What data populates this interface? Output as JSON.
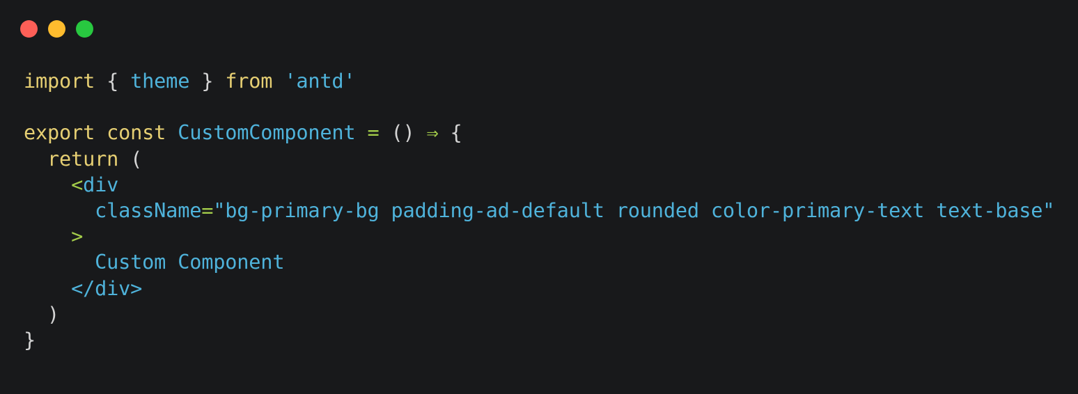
{
  "window": {
    "controls": [
      {
        "name": "close",
        "color": "#fe5f57"
      },
      {
        "name": "minimize",
        "color": "#febc2e"
      },
      {
        "name": "maximize",
        "color": "#28c840"
      }
    ]
  },
  "colors": {
    "background": "#18191b",
    "keyword": "#e6cf73",
    "identifier": "#4fb3db",
    "operator": "#a3cc4a",
    "punctuation": "#d4d4d4"
  },
  "code": {
    "lines": [
      [
        {
          "t": "import",
          "c": "kw"
        },
        {
          "t": " { ",
          "c": "punc"
        },
        {
          "t": "theme",
          "c": "id"
        },
        {
          "t": " } ",
          "c": "punc"
        },
        {
          "t": "from",
          "c": "kw"
        },
        {
          "t": " ",
          "c": "punc"
        },
        {
          "t": "'antd'",
          "c": "str"
        }
      ],
      [],
      [
        {
          "t": "export",
          "c": "kw"
        },
        {
          "t": " ",
          "c": "punc"
        },
        {
          "t": "const",
          "c": "kw"
        },
        {
          "t": " ",
          "c": "punc"
        },
        {
          "t": "CustomComponent",
          "c": "id"
        },
        {
          "t": " ",
          "c": "punc"
        },
        {
          "t": "=",
          "c": "op"
        },
        {
          "t": " () ",
          "c": "punc"
        },
        {
          "t": "⇒",
          "c": "op"
        },
        {
          "t": " {",
          "c": "punc"
        }
      ],
      [
        {
          "t": "  ",
          "c": "punc"
        },
        {
          "t": "return",
          "c": "kw"
        },
        {
          "t": " (",
          "c": "punc"
        }
      ],
      [
        {
          "t": "    ",
          "c": "punc"
        },
        {
          "t": "<",
          "c": "op"
        },
        {
          "t": "div",
          "c": "id"
        }
      ],
      [
        {
          "t": "      ",
          "c": "punc"
        },
        {
          "t": "className",
          "c": "id"
        },
        {
          "t": "=",
          "c": "op"
        },
        {
          "t": "\"bg-primary-bg padding-ad-default rounded color-primary-text text-base\"",
          "c": "str"
        }
      ],
      [
        {
          "t": "    ",
          "c": "punc"
        },
        {
          "t": ">",
          "c": "op"
        }
      ],
      [
        {
          "t": "      ",
          "c": "punc"
        },
        {
          "t": "Custom Component",
          "c": "id"
        }
      ],
      [
        {
          "t": "    ",
          "c": "punc"
        },
        {
          "t": "</div>",
          "c": "id"
        }
      ],
      [
        {
          "t": "  )",
          "c": "punc"
        }
      ],
      [
        {
          "t": "}",
          "c": "punc"
        }
      ]
    ]
  }
}
